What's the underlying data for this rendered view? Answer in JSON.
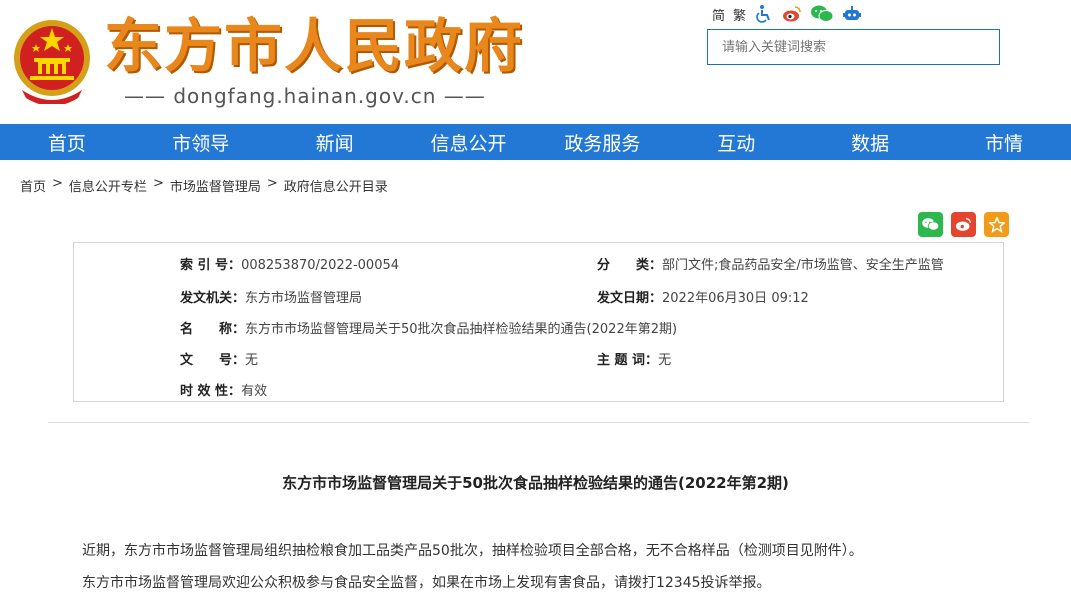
{
  "site": {
    "title": "东方市人民政府",
    "domain": "—— dongfang.hainan.gov.cn ——"
  },
  "tools": {
    "simplified": "简",
    "traditional": "繁"
  },
  "search": {
    "placeholder": "请输入关键词搜索"
  },
  "nav": [
    "首页",
    "市领导",
    "新闻",
    "信息公开",
    "政务服务",
    "互动",
    "数据",
    "市情"
  ],
  "breadcrumb": [
    "首页",
    "信息公开专栏",
    "市场监督管理局",
    "政府信息公开目录"
  ],
  "breadcrumb_sep": ">",
  "meta": {
    "index_label": "索 引 号：",
    "index_value": "008253870/2022-00054",
    "category_label": "分　　类：",
    "category_value": "部门文件;食品药品安全/市场监管、安全生产监管",
    "issuer_label": "发文机关：",
    "issuer_value": "东方市场监督管理局",
    "date_label": "发文日期：",
    "date_value": "2022年06月30日 09:12",
    "name_label": "名　　称：",
    "name_value": "东方市市场监督管理局关于50批次食品抽样检验结果的通告(2022年第2期)",
    "docno_label": "文　　号：",
    "docno_value": "无",
    "subject_label": "主 题 词：",
    "subject_value": "无",
    "validity_label": "时 效 性：",
    "validity_value": "有效"
  },
  "article": {
    "title": "东方市市场监督管理局关于50批次食品抽样检验结果的通告(2022年第2期)",
    "p1": "近期，东方市市场监督管理局组织抽检粮食加工品类产品50批次，抽样检验项目全部合格，无不合格样品（检测项目见附件）。",
    "p2": "东方市市场监督管理局欢迎公众积极参与食品安全监督，如果在市场上发现有害食品，请拨打12345投诉举报。"
  },
  "colors": {
    "nav": "#2378d5",
    "title_orange": "#e8871c",
    "wechat": "#2db84d",
    "weibo": "#e4452f",
    "favorite": "#f29b18"
  }
}
